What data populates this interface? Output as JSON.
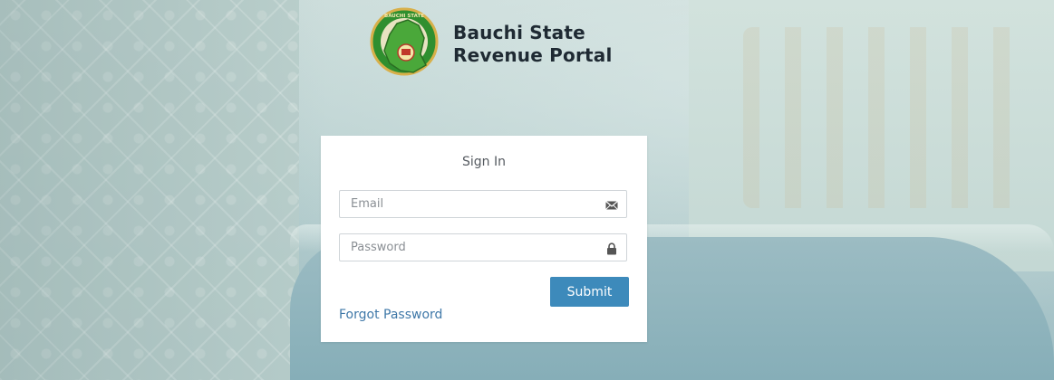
{
  "brand": {
    "line1": "Bauchi State",
    "line2": "Revenue Portal",
    "seal_text": "BAUCHI STATE OF NIGERIA"
  },
  "signin": {
    "title": "Sign In",
    "email_placeholder": "Email",
    "email_icon": "envelope-icon",
    "password_placeholder": "Password",
    "password_icon": "lock-icon",
    "submit_label": "Submit",
    "forgot_label": "Forgot Password"
  },
  "colors": {
    "accent": "#3d8abb",
    "link": "#3f78a8",
    "seal_green": "#2f8f2f",
    "seal_gold": "#d8b04a"
  }
}
